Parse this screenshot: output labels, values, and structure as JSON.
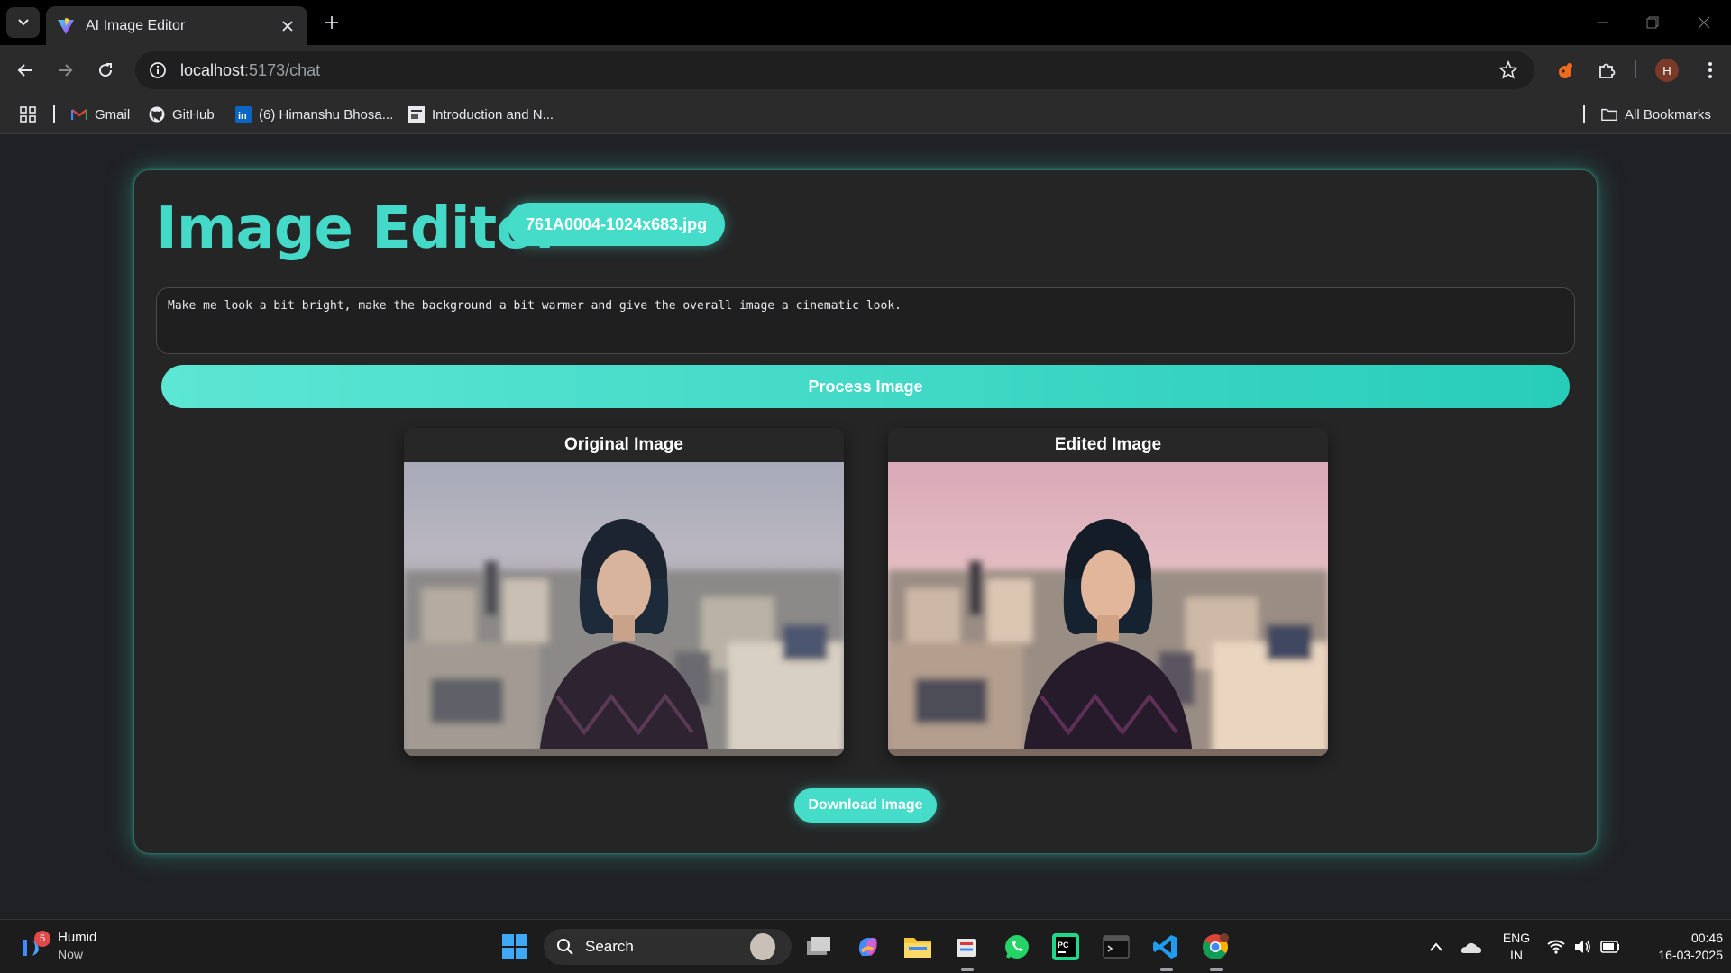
{
  "browser": {
    "tab_title": "AI Image Editor",
    "url_host": "localhost",
    "url_path": ":5173/chat",
    "bookmarks": [
      {
        "label": "Gmail",
        "icon": "gmail-icon"
      },
      {
        "label": "GitHub",
        "icon": "github-icon"
      },
      {
        "label": "(6) Himanshu Bhosa...",
        "icon": "linkedin-icon"
      },
      {
        "label": "Introduction and N...",
        "icon": "doc-icon"
      }
    ],
    "all_bookmarks": "All Bookmarks",
    "avatar_letter": "H"
  },
  "app": {
    "title": "Image Editor",
    "filename": "761A0004-1024x683.jpg",
    "prompt": "Make me look a bit bright, make the background a bit warmer and give the overall image a cinematic look.",
    "process_label": "Process Image",
    "original_label": "Original Image",
    "edited_label": "Edited Image",
    "download_label": "Download Image",
    "colors": {
      "accent": "#45dcca",
      "card": "#252526",
      "page": "#202124"
    }
  },
  "taskbar": {
    "weather_title": "Humid",
    "weather_sub": "Now",
    "weather_badge": "5",
    "search_label": "Search",
    "lang_top": "ENG",
    "lang_bottom": "IN",
    "time": "00:46",
    "date": "16-03-2025"
  }
}
